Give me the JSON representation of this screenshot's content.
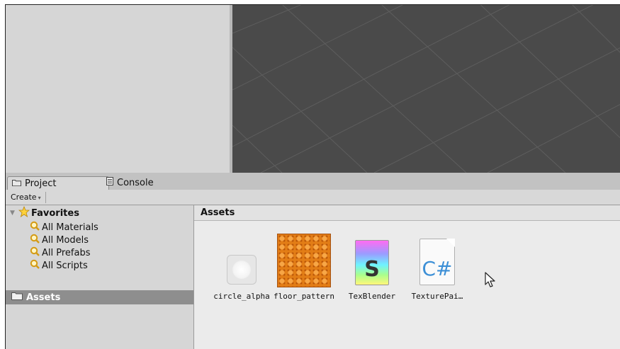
{
  "tabs": [
    {
      "label": "Project",
      "icon": "folder-icon",
      "active": true
    },
    {
      "label": "Console",
      "icon": "console-icon",
      "active": false
    }
  ],
  "toolbar": {
    "create_label": "Create",
    "create_arrow": "▾"
  },
  "favorites": {
    "header": "Favorites",
    "items": [
      {
        "label": "All Materials"
      },
      {
        "label": "All Models"
      },
      {
        "label": "All Prefabs"
      },
      {
        "label": "All Scripts"
      }
    ]
  },
  "tree": {
    "assets_label": "Assets"
  },
  "content": {
    "header": "Assets",
    "assets": [
      {
        "name": "circle_alpha",
        "kind": "texture"
      },
      {
        "name": "floor_pattern",
        "kind": "texture"
      },
      {
        "name": "TexBlender",
        "kind": "shader",
        "glyph": "S"
      },
      {
        "name": "TexturePai…",
        "kind": "csharp-script",
        "glyph": "C#"
      }
    ]
  },
  "colors": {
    "scene_background": "#4a4a4a",
    "selection": "#8e8e8e",
    "orange": "#e27d16",
    "csharp_blue": "#3c8fd6"
  }
}
